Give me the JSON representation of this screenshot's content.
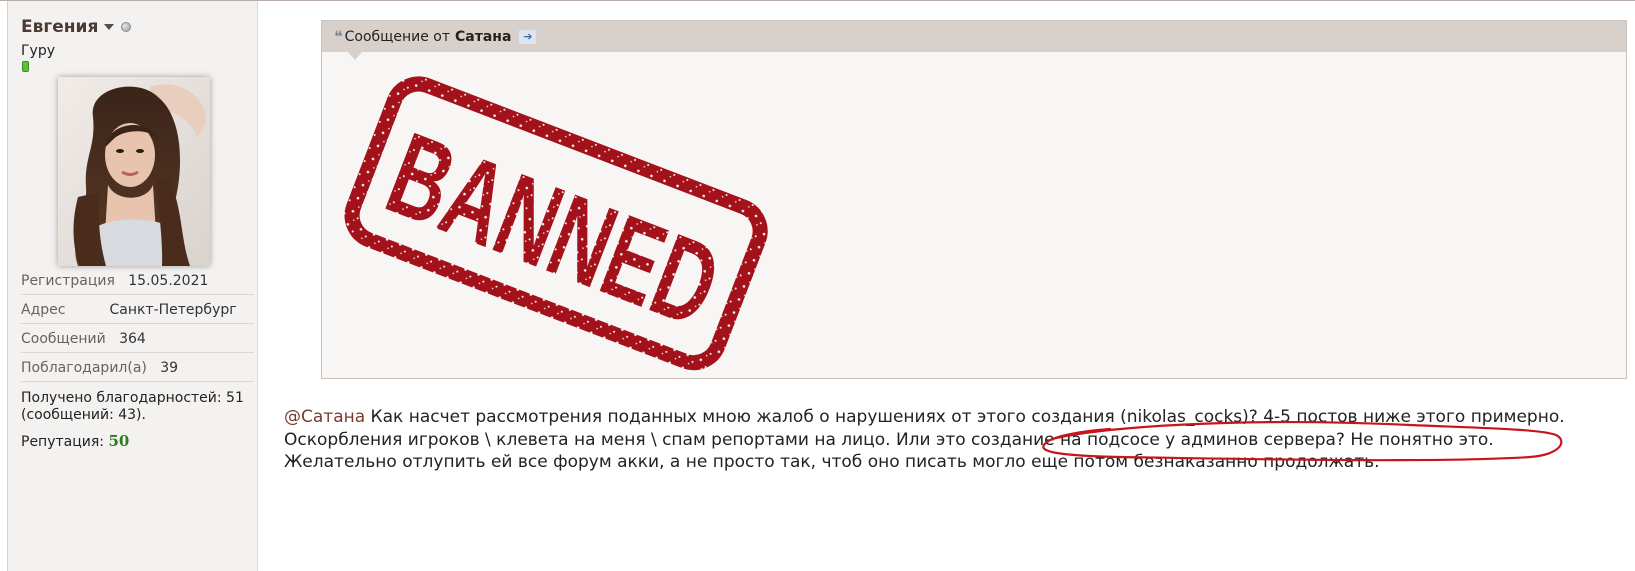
{
  "profile": {
    "username": "Евгения",
    "title": "Гуру",
    "registration_label": "Регистрация",
    "registration_value": "15.05.2021",
    "address_label": "Адрес",
    "address_value": "Санкт-Петербург",
    "messages_label": "Сообщений",
    "messages_value": "364",
    "thanked_label": "Поблагодарил(а)",
    "thanked_value": "39",
    "received_text": "Получено благодарностей: 51 (сообщений: 43).",
    "reputation_label": "Репутация:",
    "reputation_value": "50"
  },
  "quote": {
    "prefix": "Сообщение от",
    "author": "Сатана",
    "stamp_text": "BANNED"
  },
  "post": {
    "mention": "@Сатана",
    "line1": " Как насчет рассмотрения поданных мною жалоб о нарушениях от этого создания (nikolas_cocks)? 4-5 постов ниже этого примерно. Оскорбления игроков \\ клевета на меня \\ спам репортами на лицо. Или это создание на подсосе у админов сервера? Не понятно это.",
    "line2": "Желательно отлупить ей все форум акки, а не просто так, чтоб оно писать могло еще потом безнаказанно продолжать."
  },
  "colors": {
    "stamp": "#a3111b",
    "annotation": "#c8141c",
    "reputation": "#2a7d1f"
  }
}
